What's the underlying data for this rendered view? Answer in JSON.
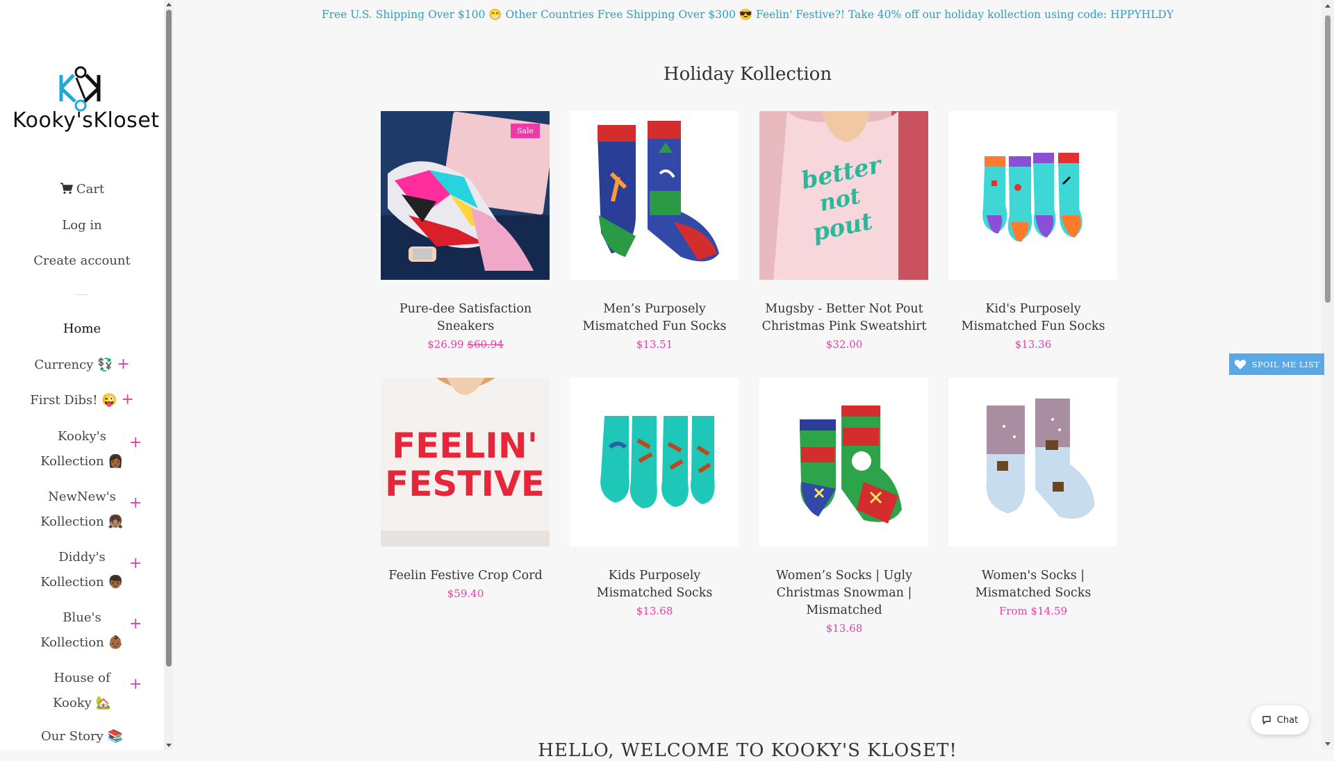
{
  "sidebar": {
    "logo_text": "Kooky'sKloset",
    "cart_label": "Cart",
    "login_label": "Log in",
    "create_account_label": "Create account",
    "home_label": "Home",
    "menu": [
      {
        "line1": "Currency 💱",
        "line2": ""
      },
      {
        "line1": "First Dibs! 😜",
        "line2": ""
      },
      {
        "line1": "Kooky's",
        "line2": "Kollection 👩🏾"
      },
      {
        "line1": "NewNew's",
        "line2": "Kollection 👧🏽"
      },
      {
        "line1": "Diddy's",
        "line2": "Kollection 👦🏾"
      },
      {
        "line1": "Blue's",
        "line2": "Kollection 👶🏾"
      },
      {
        "line1": "House of",
        "line2": "Kooky 🏡"
      },
      {
        "line1": "Our Story 📚",
        "line2": ""
      }
    ],
    "plus_symbol": "+"
  },
  "banner": "Free U.S. Shipping Over $100 😁 Other Countries Free Shipping Over $300 😎 Feelin' Festive?! Take 40% off our holiday kollection using code: HPPYHLDY",
  "section_title": "Holiday Kollection",
  "products": [
    {
      "name": "Pure-dee Satisfaction Sneakers",
      "price": "$26.99",
      "compare_price": "$60.94",
      "badge": "Sale"
    },
    {
      "name": "Men’s Purposely Mismatched Fun Socks",
      "price": "$13.51",
      "compare_price": "",
      "badge": ""
    },
    {
      "name": "Mugsby - Better Not Pout Christmas Pink Sweatshirt",
      "price": "$32.00",
      "compare_price": "",
      "badge": ""
    },
    {
      "name": "Kid's Purposely Mismatched Fun Socks",
      "price": "$13.36",
      "compare_price": "",
      "badge": ""
    },
    {
      "name": "Feelin Festive Crop Cord",
      "price": "$59.40",
      "compare_price": "",
      "badge": ""
    },
    {
      "name": "Kids Purposely Mismatched Socks",
      "price": "$13.68",
      "compare_price": "",
      "badge": ""
    },
    {
      "name": "Women’s Socks | Ugly Christmas Snowman | Mismatched",
      "price": "$13.68",
      "compare_price": "",
      "badge": ""
    },
    {
      "name": "Women's Socks | Mismatched Socks",
      "price": "From $14.59",
      "compare_price": "",
      "badge": ""
    }
  ],
  "welcome_heading": "HELLO, WELCOME TO KOOKY'S KLOSET!",
  "spoil_label": "SPOIL ME LIST",
  "chat_label": "Chat",
  "image_text": {
    "sweatshirt_line1": "better",
    "sweatshirt_line2": "not",
    "sweatshirt_line3": "pout",
    "crop_line1": "FEELIN'",
    "crop_line2": "FESTIVE"
  },
  "colors": {
    "accent_pink": "#e33fa9",
    "banner_blue": "#2c9fbf",
    "spoil_blue": "#5aa8e6",
    "logo_cyan": "#1fa9d6"
  },
  "icons": [
    "cart-icon",
    "heart-icon",
    "chat-bubble-icon",
    "plus-icon"
  ]
}
